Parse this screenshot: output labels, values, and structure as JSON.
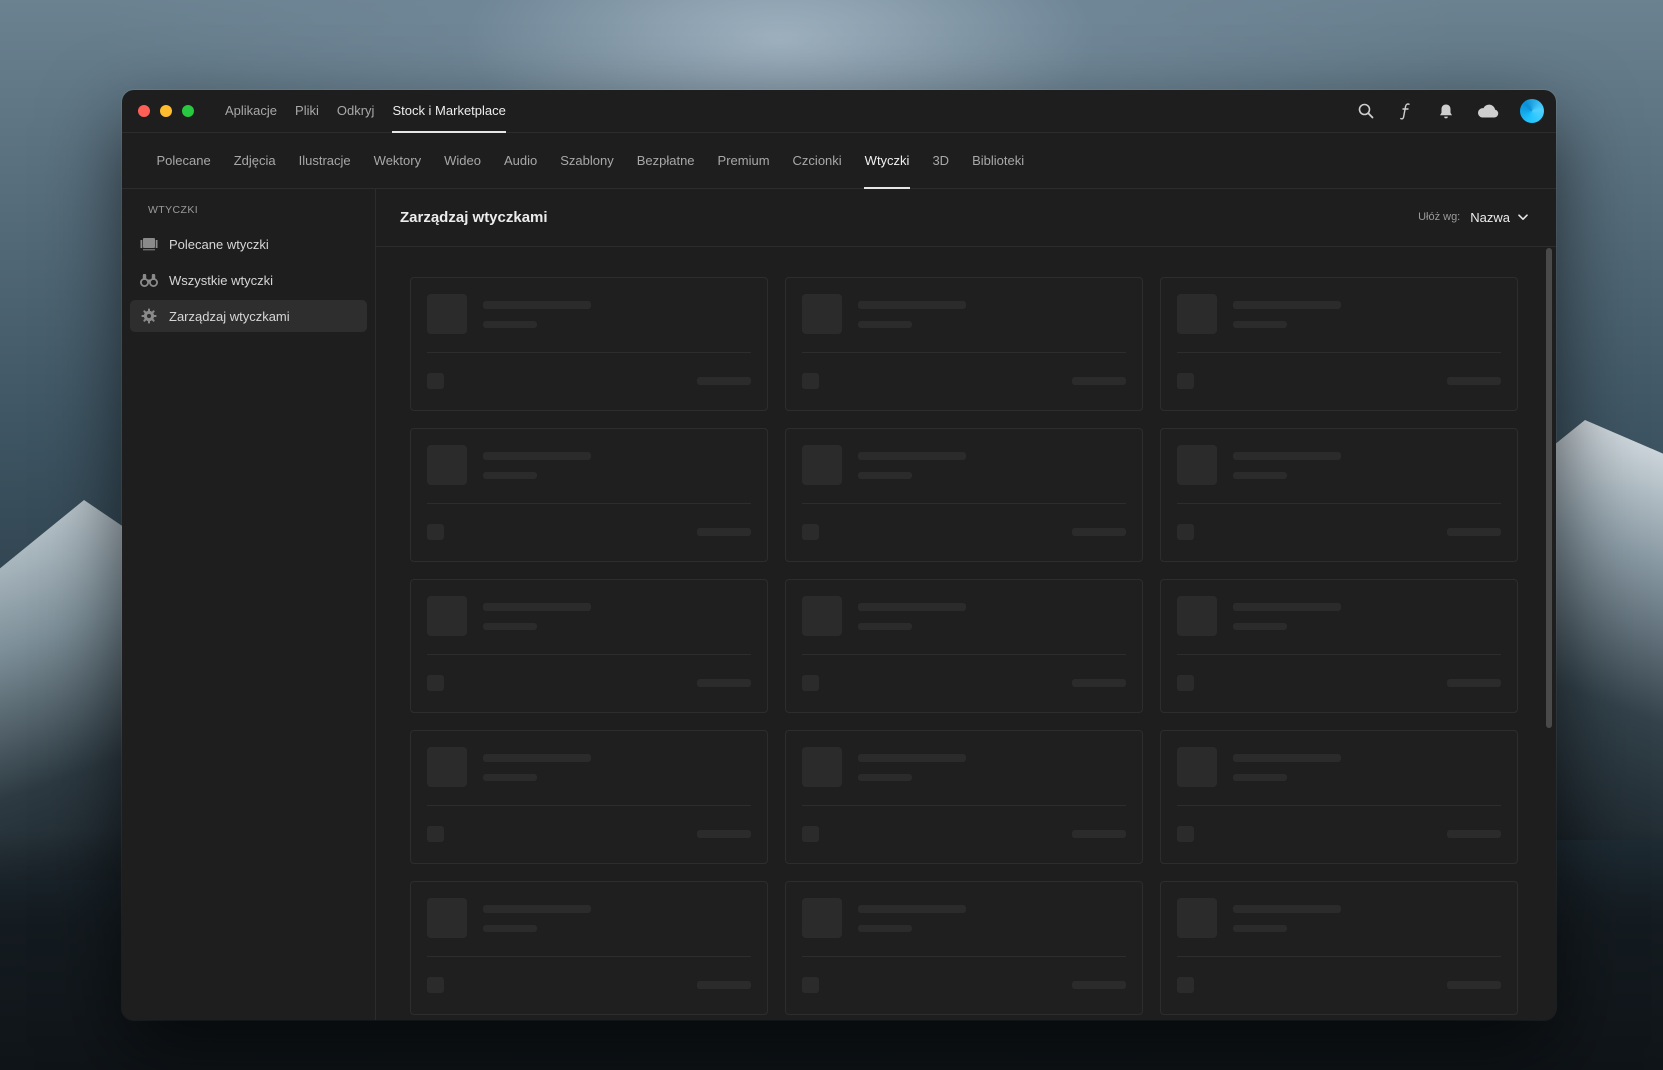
{
  "app": {
    "nav": [
      "Aplikacje",
      "Pliki",
      "Odkryj",
      "Stock i Marketplace"
    ],
    "active_nav": 3
  },
  "title_icons": [
    "search-icon",
    "fonts-icon",
    "bell-icon",
    "cloud-icon",
    "avatar"
  ],
  "categories": {
    "items": [
      "Polecane",
      "Zdjęcia",
      "Ilustracje",
      "Wektory",
      "Wideo",
      "Audio",
      "Szablony",
      "Bezpłatne",
      "Premium",
      "Czcionki",
      "Wtyczki",
      "3D",
      "Biblioteki"
    ],
    "active": 10
  },
  "sidebar": {
    "heading": "WTYCZKI",
    "items": [
      {
        "label": "Polecane wtyczki",
        "icon": "featured-plugins-icon"
      },
      {
        "label": "Wszystkie wtyczki",
        "icon": "binoculars-icon"
      },
      {
        "label": "Zarządzaj wtyczkami",
        "icon": "gear-icon"
      }
    ],
    "active": 2
  },
  "main": {
    "title": "Zarządzaj wtyczkami",
    "sort_label": "Ułóż wg:",
    "sort_value": "Nazwa"
  }
}
